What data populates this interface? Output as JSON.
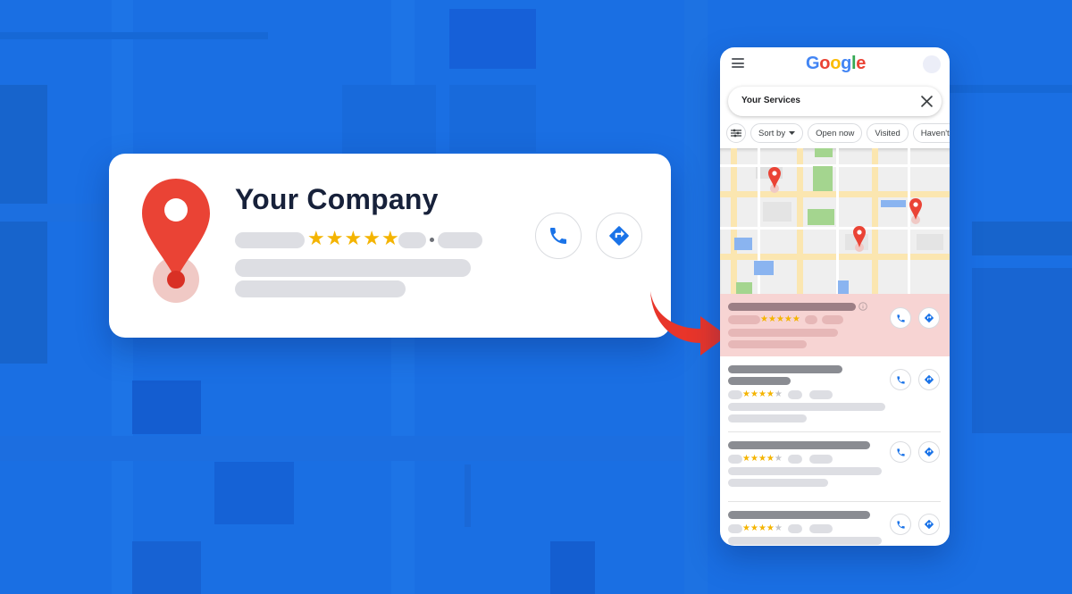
{
  "colors": {
    "background": "#1a6fe3",
    "accent_red": "#ea4335",
    "star": "#f4b400",
    "icon_blue": "#1a73e8"
  },
  "card": {
    "title": "Your Company",
    "rating_stars": 5,
    "icons": [
      "map-pin-icon",
      "phone-icon",
      "directions-icon"
    ]
  },
  "google": {
    "logo_letters": [
      "G",
      "o",
      "o",
      "g",
      "l",
      "e"
    ],
    "logo_colors": [
      "#4285f4",
      "#ea4335",
      "#fbbc05",
      "#4285f4",
      "#34a853",
      "#ea4335"
    ]
  },
  "search": {
    "query": "Your Services"
  },
  "filters": {
    "chips": [
      "Sort by",
      "Open now",
      "Visited",
      "Haven't"
    ]
  },
  "results": [
    {
      "rating": 5,
      "highlighted": true
    },
    {
      "rating": 4,
      "highlighted": false
    },
    {
      "rating": 4,
      "highlighted": false
    },
    {
      "rating": 4,
      "highlighted": false
    }
  ]
}
